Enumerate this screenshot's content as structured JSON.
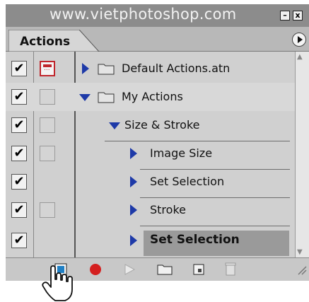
{
  "watermark": "www.vietphotoshop.com",
  "panel": {
    "tab_label": "Actions",
    "minimize_label": "–",
    "close_label": "x"
  },
  "rows": [
    {
      "level": 0,
      "expanded": false,
      "type": "set",
      "label": "Default Actions.atn",
      "checked": true,
      "dialog": true
    },
    {
      "level": 0,
      "expanded": true,
      "type": "set",
      "label": "My Actions",
      "checked": true,
      "dialog": false
    },
    {
      "level": 1,
      "expanded": true,
      "type": "action",
      "label": "Size & Stroke",
      "checked": true,
      "dialog": false
    },
    {
      "level": 2,
      "expanded": false,
      "type": "command",
      "label": "Image Size",
      "checked": true,
      "dialog": false
    },
    {
      "level": 2,
      "expanded": false,
      "type": "command",
      "label": "Set Selection",
      "checked": true,
      "dialog": null
    },
    {
      "level": 2,
      "expanded": false,
      "type": "command",
      "label": "Stroke",
      "checked": true,
      "dialog": false
    },
    {
      "level": 2,
      "expanded": false,
      "type": "command",
      "label": "Set Selection",
      "checked": true,
      "dialog": null,
      "selected": true
    }
  ],
  "check_glyph": "✔",
  "toolbar": [
    "stop-icon",
    "record-icon",
    "play-icon",
    "new-set-icon",
    "new-action-icon",
    "delete-icon"
  ],
  "colors": {
    "record": "#d42020",
    "triangle": "#1e3aa8",
    "dialog": "#c0262c"
  }
}
